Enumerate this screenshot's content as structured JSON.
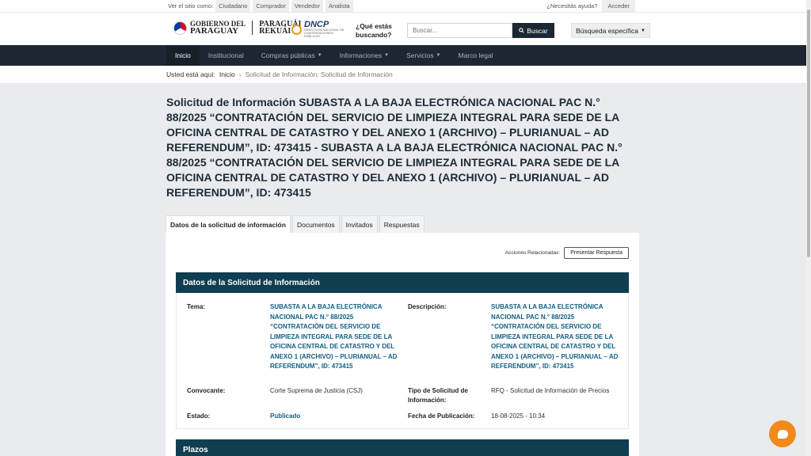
{
  "topbar": {
    "view_as_label": "Ver el sitio como:",
    "roles": [
      "Ciudadano",
      "Comprador",
      "Vendedor",
      "Analista"
    ],
    "help": "¿Necesitás ayuda?",
    "login": "Acceder"
  },
  "header": {
    "gov_line1": "GOBIERNO DEL",
    "gov_line2": "PARAGUAY",
    "gov_line3": "PARAGUÁI",
    "gov_line4": "REKUÁI",
    "dncp": "DNCP",
    "dncp_sub": "DIRECCIÓN NACIONAL DE CONTRATACIONES PÚBLICAS",
    "question_line1": "¿Qué estás",
    "question_line2": "buscando?",
    "search_placeholder": "Buscar...",
    "search_button": "Buscar",
    "advanced_button": "Búsqueda específica"
  },
  "nav": {
    "items": [
      "Inicio",
      "Institucional",
      "Compras públicas",
      "Informaciones",
      "Servicios",
      "Marco legal"
    ]
  },
  "breadcrumb": {
    "prefix": "Usted está aquí:",
    "home": "Inicio",
    "current": "Solicitud de Información: Solicitud de Información"
  },
  "page_title": "Solicitud de Información SUBASTA A LA BAJA ELECTRÓNICA NACIONAL PAC N.° 88/2025 “CONTRATACIÓN DEL SERVICIO DE LIMPIEZA INTEGRAL PARA SEDE DE LA OFICINA CENTRAL DE CATASTRO Y DEL ANEXO 1 (ARCHIVO) – PLURIANUAL – AD REFERENDUM”, ID: 473415 - SUBASTA A LA BAJA ELECTRÓNICA NACIONAL PAC N.° 88/2025 “CONTRATACIÓN DEL SERVICIO DE LIMPIEZA INTEGRAL PARA SEDE DE LA OFICINA CENTRAL DE CATASTRO Y DEL ANEXO 1 (ARCHIVO) – PLURIANUAL – AD REFERENDUM”, ID: 473415",
  "tabs": [
    "Datos de la solicitud de información",
    "Documentos",
    "Invitados",
    "Respuestas"
  ],
  "actions": {
    "label": "Acciones Relacionadas:",
    "button": "Presentar Respuesta"
  },
  "section_data": {
    "title": "Datos de la Solicitud de Información",
    "tema_label": "Tema:",
    "tema_value": "SUBASTA A LA BAJA ELECTRÓNICA NACIONAL PAC N.° 88/2025 “CONTRATACIÓN DEL SERVICIO DE LIMPIEZA INTEGRAL PARA SEDE DE LA OFICINA CENTRAL DE CATASTRO Y DEL ANEXO 1 (ARCHIVO) – PLURIANUAL – AD REFERENDUM”, ID: 473415",
    "descripcion_label": "Descripción:",
    "descripcion_value": "SUBASTA A LA BAJA ELECTRÓNICA NACIONAL PAC N.° 88/2025 “CONTRATACIÓN DEL SERVICIO DE LIMPIEZA INTEGRAL PARA SEDE DE LA OFICINA CENTRAL DE CATASTRO Y DEL ANEXO 1 (ARCHIVO) – PLURIANUAL – AD REFERENDUM”, ID: 473415",
    "convocante_label": "Convocante:",
    "convocante_value": "Corte Suprema de Justicia (CSJ)",
    "tipo_label": "Tipo de Solicitud de Información:",
    "tipo_value": "RFQ - Solicitud de Información de Precios",
    "estado_label": "Estado:",
    "estado_value": "Publicado",
    "fecha_label": "Fecha de Publicación:",
    "fecha_value": "18-08-2025 - 10:34"
  },
  "section_plazos": {
    "title": "Plazos"
  },
  "colors": {
    "nav_bg": "#1c2733",
    "section_bg": "#0f3e50",
    "link": "#0f5f86",
    "chat": "#f08a1c"
  }
}
